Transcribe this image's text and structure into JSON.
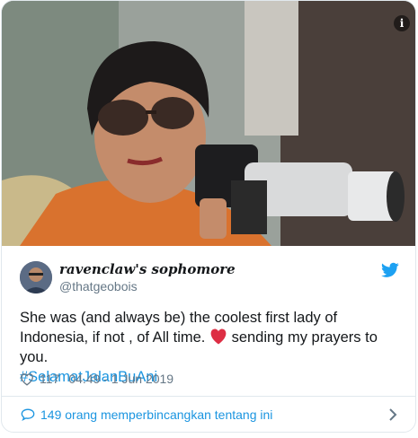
{
  "media": {
    "info_icon": "info-icon",
    "photo_description_icon": "photo"
  },
  "author": {
    "display_name": "ravenclaw's sophomore",
    "handle": "@thatgeobois",
    "avatar_icon": "avatar",
    "platform_icon": "twitter-bird-icon"
  },
  "tweet": {
    "text_part1": "She was (and always be) the coolest first lady of Indonesia, if not , of All time.",
    "text_part2": "sending my prayers to you.",
    "hashtag": "#SelamatJalanBuAni",
    "emoji_icon": "red-heart-emoji"
  },
  "meta": {
    "likes": "117",
    "timestamp": "04.49 - 1 Jun 2019"
  },
  "conversation": {
    "label": "149 orang memperbincangkan tentang ini"
  },
  "colors": {
    "link": "#1b95e0",
    "text": "#14171a",
    "secondary": "#657786",
    "border": "#e1e8ed"
  }
}
